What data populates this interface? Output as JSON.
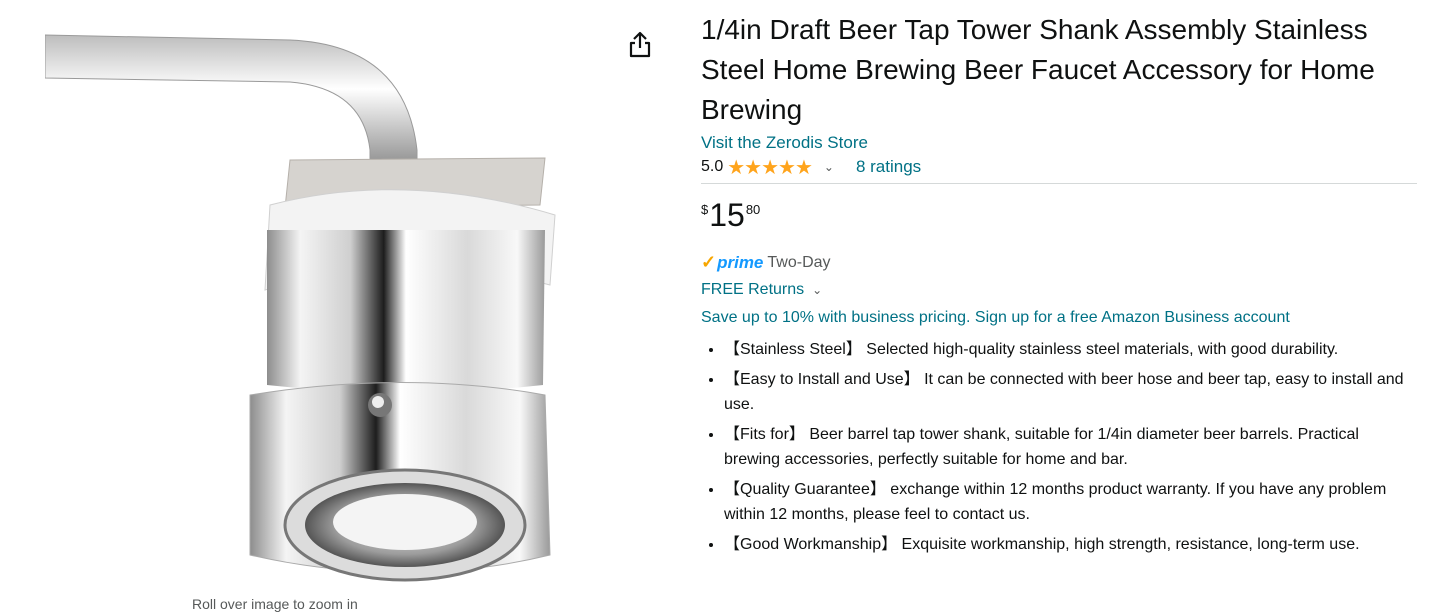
{
  "product": {
    "title": "1/4in Draft Beer Tap Tower Shank Assembly Stainless Steel Home Brewing Beer Faucet Accessory for Home Brewing",
    "store_link": "Visit the Zerodis Store",
    "rating_value": "5.0",
    "stars": "★★★★★",
    "rating_chevron": "⌄",
    "ratings_link": "8 ratings",
    "price": {
      "symbol": "$",
      "whole": "15",
      "fraction": "80"
    },
    "prime": {
      "check": "✓",
      "label": "prime",
      "speed": "Two-Day"
    },
    "returns_label": "FREE Returns",
    "returns_chevron": "⌄",
    "business_text": "Save up to 10% with business pricing. Sign up for a free Amazon Business account",
    "bullets": [
      "【Stainless Steel】 Selected high-quality stainless steel materials, with good durability.",
      "【Easy to Install and Use】 It can be connected with beer hose and beer tap, easy to install and use.",
      "【Fits for】 Beer barrel tap tower shank, suitable for 1/4in diameter beer barrels. Practical brewing accessories, perfectly suitable for home and bar.",
      "【Quality Guarantee】 exchange within 12 months product warranty. If you have any problem within 12 months, please feel to contact us.",
      "【Good Workmanship】 Exquisite workmanship, high strength, resistance, long-term use."
    ]
  },
  "image_pane": {
    "zoom_hint": "Roll over image to zoom in",
    "share_icon": "share-icon"
  },
  "colors": {
    "link": "#007185",
    "star": "#FFA41C",
    "prime": "#1399FF",
    "prime_check": "#F7A600"
  }
}
